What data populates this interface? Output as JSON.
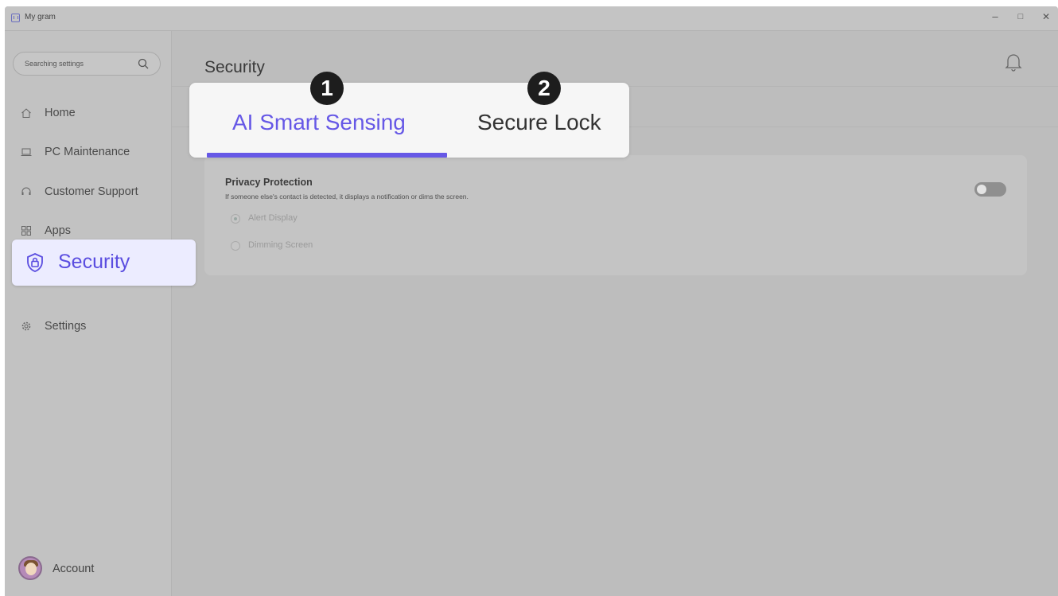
{
  "window": {
    "title": "My gram",
    "controls": [
      "–",
      "□",
      "✕"
    ]
  },
  "sidebar": {
    "search_placeholder": "Searching settings",
    "items": [
      {
        "label": "Home",
        "icon": "home-icon"
      },
      {
        "label": "PC Maintenance",
        "icon": "laptop-icon"
      },
      {
        "label": "Customer Support",
        "icon": "headset-icon"
      },
      {
        "label": "Apps",
        "icon": "apps-grid-icon"
      },
      {
        "label": "Security",
        "icon": "shield-lock-icon",
        "selected": true
      },
      {
        "label": "Settings",
        "icon": "gear-icon"
      }
    ],
    "account_label": "Account"
  },
  "main": {
    "page_title": "Security",
    "tabs": [
      {
        "label": "AI Smart Sensing",
        "active": true,
        "callout": "1"
      },
      {
        "label": "Secure Lock",
        "active": false,
        "callout": "2"
      }
    ],
    "card": {
      "title": "Privacy Protection",
      "description": "If someone else's contact is detected, it displays a notification or dims the screen.",
      "toggle_on": false,
      "options": [
        {
          "label": "Alert Display",
          "selected": true
        },
        {
          "label": "Dimming Screen",
          "selected": false
        }
      ]
    }
  },
  "colors": {
    "accent": "#6658e6",
    "highlight_bg": "#ececff",
    "badge_bg": "#1d1d1d"
  }
}
